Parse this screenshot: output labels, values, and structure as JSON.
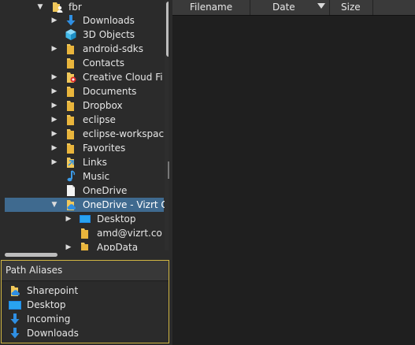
{
  "tree": {
    "items": [
      {
        "label": "fbr",
        "icon": "user-folder-icon",
        "expanded": true,
        "selected": false
      },
      {
        "label": "Downloads",
        "icon": "download-arrow-icon",
        "expanded": false,
        "selected": false
      },
      {
        "label": "3D Objects",
        "icon": "cube-icon",
        "expanded": false,
        "selected": false
      },
      {
        "label": "android-sdks",
        "icon": "folder-icon",
        "expanded": false,
        "selected": false
      },
      {
        "label": "Contacts",
        "icon": "folder-icon",
        "expanded": false,
        "selected": false
      },
      {
        "label": "Creative Cloud Fi",
        "icon": "creative-cloud-folder-icon",
        "expanded": false,
        "selected": false
      },
      {
        "label": "Documents",
        "icon": "folder-icon",
        "expanded": false,
        "selected": false
      },
      {
        "label": "Dropbox",
        "icon": "folder-icon",
        "expanded": false,
        "selected": false
      },
      {
        "label": "eclipse",
        "icon": "folder-icon",
        "expanded": false,
        "selected": false
      },
      {
        "label": "eclipse-workspac",
        "icon": "folder-icon",
        "expanded": false,
        "selected": false
      },
      {
        "label": "Favorites",
        "icon": "folder-icon",
        "expanded": false,
        "selected": false
      },
      {
        "label": "Links",
        "icon": "link-folder-icon",
        "expanded": false,
        "selected": false
      },
      {
        "label": "Music",
        "icon": "music-note-icon",
        "expanded": false,
        "selected": false
      },
      {
        "label": "OneDrive",
        "icon": "document-icon",
        "expanded": false,
        "selected": false
      },
      {
        "label": "OneDrive - Vizrt C",
        "icon": "onedrive-folder-icon",
        "expanded": true,
        "selected": true
      },
      {
        "label": "Desktop",
        "icon": "desktop-folder-icon",
        "expanded": false,
        "selected": false
      },
      {
        "label": "amd@vizrt.co",
        "icon": "folder-icon",
        "expanded": false,
        "selected": false
      },
      {
        "label": "AppData",
        "icon": "folder-icon",
        "expanded": false,
        "selected": false
      }
    ]
  },
  "aliases": {
    "title": "Path Aliases",
    "items": [
      {
        "label": "Sharepoint",
        "icon": "onedrive-folder-icon"
      },
      {
        "label": "Desktop",
        "icon": "desktop-folder-icon"
      },
      {
        "label": "Incoming",
        "icon": "download-arrow-icon"
      },
      {
        "label": "Downloads",
        "icon": "download-arrow-icon"
      }
    ]
  },
  "file_list": {
    "columns": [
      {
        "label": "Filename"
      },
      {
        "label": "Date",
        "sorted": "descending"
      },
      {
        "label": "Size"
      }
    ]
  },
  "colors": {
    "selection": "#3f6a8f",
    "panel_border": "#d2b843",
    "folder": "#f1c85a",
    "accent_blue": "#2f8fe3"
  }
}
